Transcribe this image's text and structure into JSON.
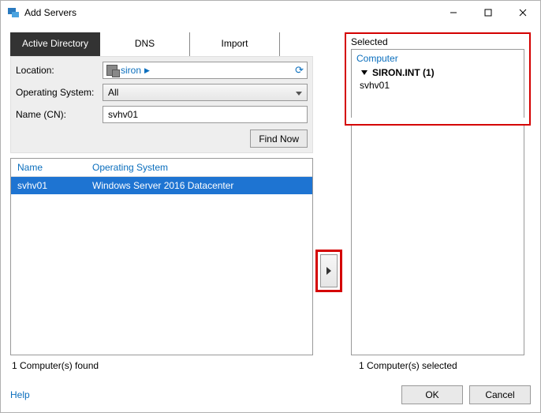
{
  "window": {
    "title": "Add Servers"
  },
  "tabs": {
    "active": "Active Directory",
    "dns": "DNS",
    "import": "Import"
  },
  "filters": {
    "location_label": "Location:",
    "location_value": "siron",
    "os_label": "Operating System:",
    "os_value": "All",
    "name_label": "Name (CN):",
    "name_value": "svhv01",
    "find_now": "Find Now"
  },
  "results": {
    "col_name": "Name",
    "col_os": "Operating System",
    "rows": [
      {
        "name": "svhv01",
        "os": "Windows Server 2016 Datacenter"
      }
    ]
  },
  "selected": {
    "title": "Selected",
    "header": "Computer",
    "group": "SIRON.INT (1)",
    "items": [
      "svhv01"
    ]
  },
  "status": {
    "found": "1 Computer(s) found",
    "selected": "1 Computer(s) selected"
  },
  "footer": {
    "help": "Help",
    "ok": "OK",
    "cancel": "Cancel"
  }
}
